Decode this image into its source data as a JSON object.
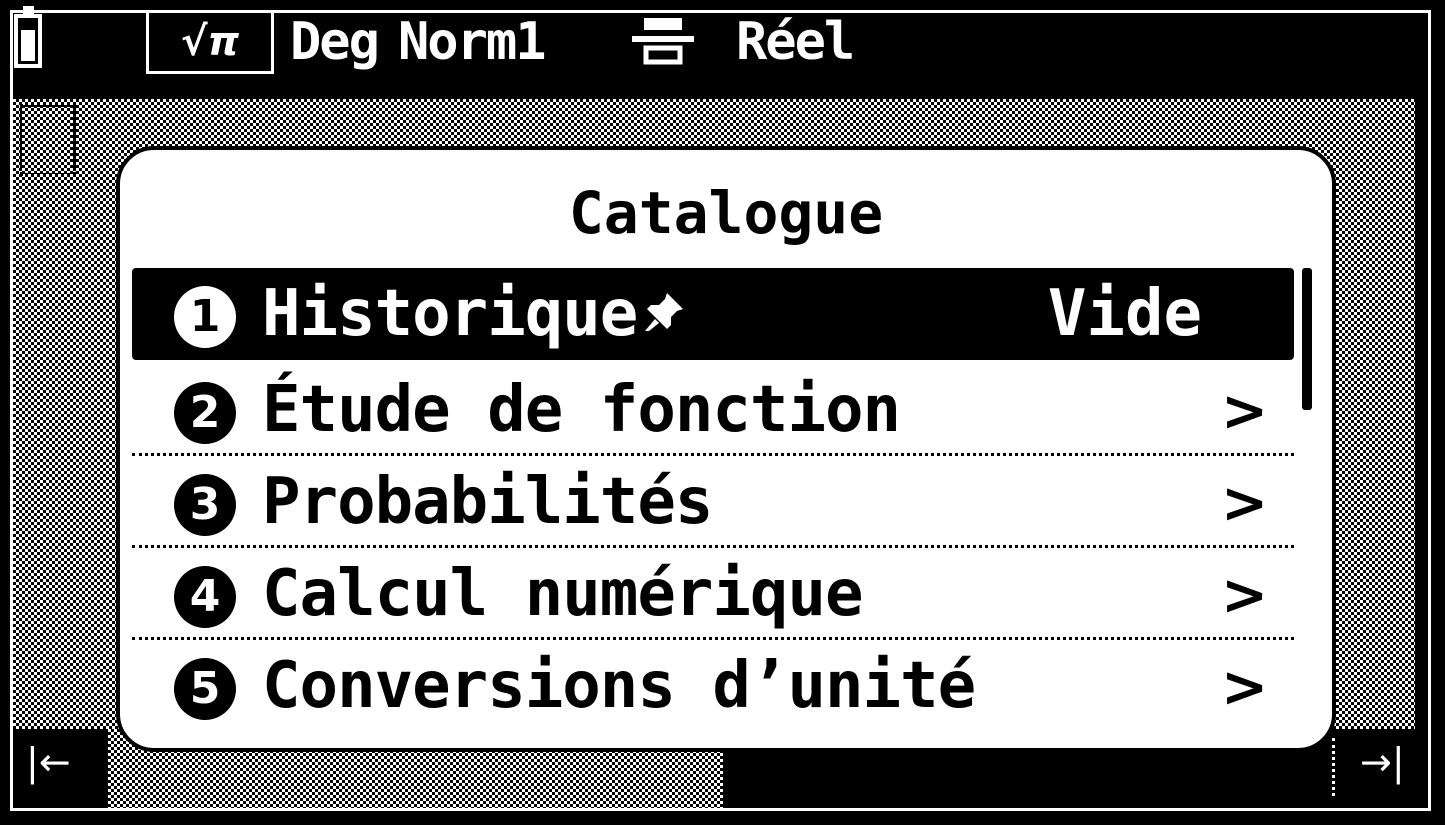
{
  "status_bar": {
    "mode_label": "√π",
    "angle_unit": "Deg",
    "display_format": "Norm1",
    "format_icon": "fraction-format-icon",
    "complex_mode": "Réel",
    "battery_icon": "battery-icon"
  },
  "catalogue": {
    "title": "Catalogue",
    "items": [
      {
        "number": "1",
        "label": "Historique",
        "pin_icon": "pin-icon",
        "value": "Vide",
        "selected": true
      },
      {
        "number": "2",
        "label": "Étude de fonction",
        "chevron": ">"
      },
      {
        "number": "3",
        "label": "Probabilités",
        "chevron": ">"
      },
      {
        "number": "4",
        "label": "Calcul numérique",
        "chevron": ">"
      },
      {
        "number": "5",
        "label": "Conversions d’unité",
        "chevron": ">"
      }
    ]
  },
  "bottom_bar": {
    "nav_left": "|←",
    "nav_right": "→|"
  },
  "colors": {
    "foreground": "#000000",
    "background": "#ffffff"
  }
}
